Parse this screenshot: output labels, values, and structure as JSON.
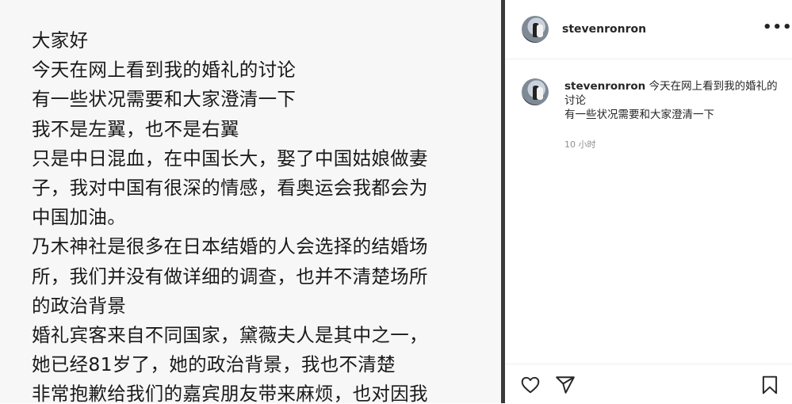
{
  "post": {
    "lines": [
      "大家好",
      "今天在网上看到我的婚礼的讨论",
      "有一些状况需要和大家澄清一下",
      "我不是左翼，也不是右翼",
      "只是中日混血，在中国长大，娶了中国姑娘做妻",
      "子，我对中国有很深的情感，看奥运会我都会为",
      "中国加油。",
      "乃木神社是很多在日本结婚的人会选择的结婚场",
      "所，我们并没有做详细的调查，也并不清楚场所",
      "的政治背景",
      "婚礼宾客来自不同国家，黛薇夫人是其中之一，",
      "她已经81岁了，她的政治背景，我也不清楚",
      "非常抱歉给我们的嘉宾朋友带来麻烦，也对因我"
    ]
  },
  "header": {
    "username": "stevenronron",
    "more": "•••"
  },
  "caption": {
    "username": "stevenronron",
    "text_1": "今天在网上看到我的婚礼的讨论",
    "text_2": "有一些状况需要和大家澄清一下",
    "time": "10 小时"
  },
  "icons": {
    "like": "heart-icon",
    "share": "send-icon",
    "save": "bookmark-icon",
    "more": "more-options-icon"
  },
  "colors": {
    "divider": "#3a3a3a",
    "text": "#262626",
    "muted": "#8e8e8e",
    "image_bg": "#f7f7f7"
  }
}
